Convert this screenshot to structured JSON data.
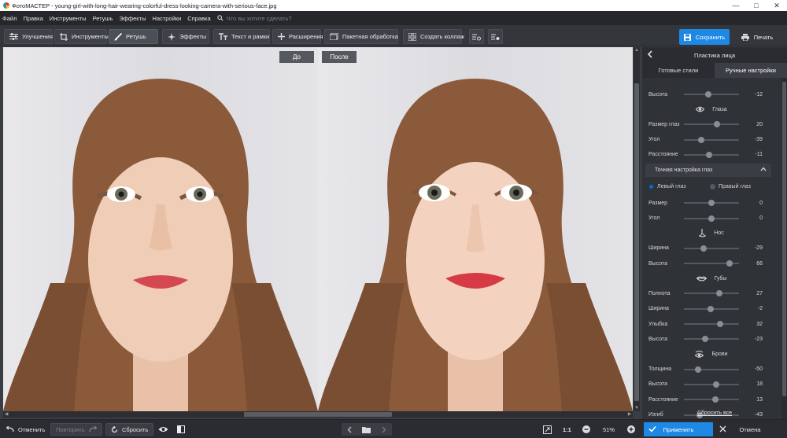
{
  "window": {
    "title": "ФотоМАСТЕР - young-girl-with-long-hair-wearing-colorful-dress-looking-camera-with-serious-face.jpg"
  },
  "menu": {
    "items": [
      "Файл",
      "Правка",
      "Инструменты",
      "Ретушь",
      "Эффекты",
      "Настройки",
      "Справка"
    ],
    "search_placeholder": "Что вы хотите сделать?"
  },
  "toolbar": {
    "tabs": [
      {
        "label": "Улучшения",
        "icon": "sliders-icon"
      },
      {
        "label": "Инструменты",
        "icon": "crop-icon"
      },
      {
        "label": "Ретушь",
        "icon": "brush-icon",
        "active": true
      },
      {
        "label": "Эффекты",
        "icon": "sparkle-icon"
      },
      {
        "label": "Текст и рамки",
        "icon": "text-icon"
      },
      {
        "label": "Расширения",
        "icon": "plus-icon"
      }
    ],
    "batch_label": "Пакетная обработка",
    "collage_label": "Создать коллаж",
    "save_label": "Сохранить",
    "print_label": "Печать"
  },
  "canvas": {
    "before_label": "До",
    "after_label": "После"
  },
  "panel": {
    "title": "Пластика лица",
    "tabs": [
      "Готовые стили",
      "Ручные настройки"
    ],
    "active_tab": 1,
    "rows": [
      {
        "label": "Высота",
        "value": "-12",
        "level": 0.44
      },
      {
        "section": "Глаза",
        "icon": "eye-icon"
      },
      {
        "label": "Размер глаз",
        "value": "20",
        "level": 0.6
      },
      {
        "label": "Угол",
        "value": "-39",
        "level": 0.31
      },
      {
        "label": "Расстояние",
        "value": "-11",
        "level": 0.45
      },
      {
        "subhead": "Точная настройка глаз"
      },
      {
        "radios": [
          "Левый глаз",
          "Правый глаз"
        ],
        "selected": 0
      },
      {
        "label": "Размер",
        "value": "0",
        "level": 0.5
      },
      {
        "label": "Угол",
        "value": "0",
        "level": 0.5
      },
      {
        "section": "Нос",
        "icon": "nose-icon"
      },
      {
        "label": "Ширина",
        "value": "-29",
        "level": 0.36
      },
      {
        "label": "Высота",
        "value": "66",
        "level": 0.83
      },
      {
        "section": "Губы",
        "icon": "lips-icon"
      },
      {
        "label": "Полнота",
        "value": "27",
        "level": 0.64
      },
      {
        "label": "Ширина",
        "value": "-2",
        "level": 0.49
      },
      {
        "label": "Улыбка",
        "value": "32",
        "level": 0.66
      },
      {
        "label": "Высота",
        "value": "-23",
        "level": 0.39
      },
      {
        "section": "Брови",
        "icon": "brow-icon"
      },
      {
        "label": "Толщина",
        "value": "-50",
        "level": 0.25
      },
      {
        "label": "Высота",
        "value": "18",
        "level": 0.59
      },
      {
        "label": "Расстояние",
        "value": "13",
        "level": 0.57
      },
      {
        "label": "Изгиб",
        "value": "-43",
        "level": 0.29
      }
    ],
    "reset_all": "Сбросить все"
  },
  "bottom": {
    "undo": "Отменить",
    "redo": "Повторить",
    "reset": "Сбросить",
    "ratio": "1:1",
    "zoom": "51%",
    "apply": "Применить",
    "cancel": "Отмена"
  },
  "colors": {
    "accent": "#1e88e5",
    "panel_bg": "#2f3237",
    "app_bg": "#33363b"
  }
}
